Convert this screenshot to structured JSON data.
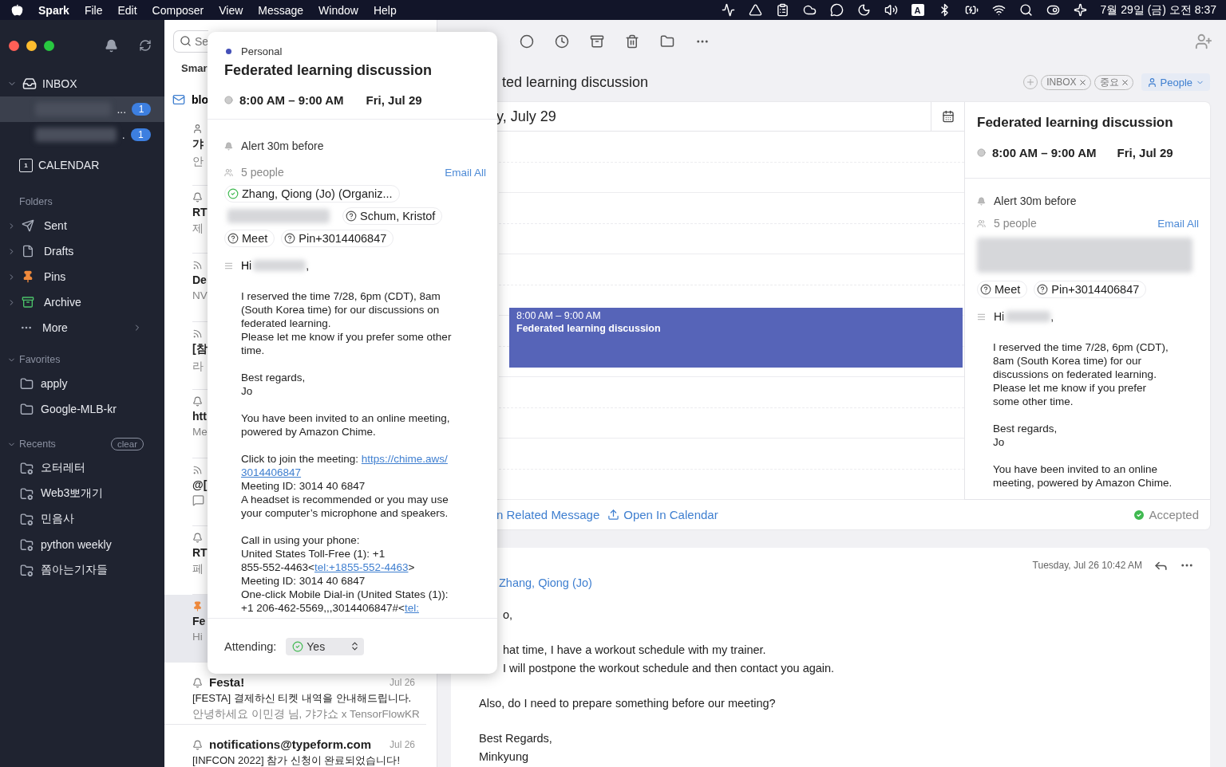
{
  "menu_bar": {
    "app": "Spark",
    "menus": [
      "File",
      "Edit",
      "Composer",
      "View",
      "Message",
      "Window",
      "Help"
    ],
    "input_source": "A",
    "clock": "7월 29일 (금) 오전 8:37"
  },
  "sidebar": {
    "inbox": {
      "label": "INBOX",
      "expanded": true,
      "accounts": [
        {
          "tail": "...",
          "count": "1",
          "selected": true
        },
        {
          "tail": ".",
          "count": "1",
          "selected": false
        }
      ]
    },
    "calendar": {
      "label": "CALENDAR",
      "day": "1"
    },
    "folders": {
      "title": "Folders",
      "items": [
        {
          "label": "Sent",
          "kind": "sent",
          "expanded": false
        },
        {
          "label": "Drafts",
          "kind": "drafts",
          "expanded": false
        },
        {
          "label": "Pins",
          "kind": "pins",
          "expanded": false
        },
        {
          "label": "Archive",
          "kind": "archive",
          "expanded": false
        },
        {
          "label": "More",
          "kind": "more"
        }
      ]
    },
    "favorites": {
      "title": "Favorites",
      "expanded": true,
      "items": [
        "apply",
        "Google-MLB-kr"
      ]
    },
    "recents": {
      "title": "Recents",
      "expanded": true,
      "clear": "clear",
      "items": [
        "오터레터",
        "Web3뽀개기",
        "민음사",
        "python weekly",
        "쫌아는기자들"
      ]
    }
  },
  "message_list": {
    "search_placeholder": "Se",
    "tab": "Smar",
    "header": "blo",
    "items": [
      {
        "kind": "person",
        "title": "갸",
        "preview": "안",
        "selected": false
      },
      {
        "kind": "bell",
        "title": "RT",
        "preview": "제",
        "selected": false
      },
      {
        "kind": "rss",
        "title": "De",
        "preview": "NV",
        "selected": false
      },
      {
        "kind": "rss",
        "title": "[참",
        "preview": "라",
        "selected": false
      },
      {
        "kind": "bell",
        "title": "htt",
        "preview": "Me",
        "selected": false
      },
      {
        "kind": "rss",
        "title": "@[",
        "chat_icon": true,
        "selected": false
      },
      {
        "kind": "bell",
        "title": "RT",
        "preview": "페",
        "selected": false
      },
      {
        "kind": "pin",
        "title": "Fe",
        "preview": "Hi",
        "selected": true
      }
    ],
    "full_items": [
      {
        "sender": "Festa!",
        "date": "Jul 26",
        "subject": "[FESTA] 결제하신 티켓 내역을 안내해드립니다.",
        "preview": "안녕하세요 이민경 님, 갸갸쇼 x TensorFlowKR",
        "selected": false
      },
      {
        "sender": "notifications@typeform.com",
        "date": "Jul 26",
        "subject": "[INFCON 2022] 참가 신청이 완료되었습니다!",
        "selected": false
      }
    ]
  },
  "thread": {
    "subject": "ted learning discussion",
    "tags": [
      "INBOX",
      "중요"
    ],
    "people": "People",
    "event_card": {
      "day": "y, July 29",
      "event": {
        "time": "8:00 AM – 9:00 AM",
        "title": "Federated learning discussion"
      },
      "details": {
        "title": "Federated learning discussion",
        "time": "8:00 AM – 9:00 AM",
        "date": "Fri, Jul 29",
        "alert": "Alert 30m before",
        "people": "5 people",
        "email_all": "Email All",
        "chips": [
          {
            "label": "Meet",
            "accepted": false
          },
          {
            "label": "Pin+3014406847",
            "accepted": false
          }
        ],
        "greeting": "Hi",
        "greeting_end": ",",
        "paragraphs": [
          [
            "I reserved the time 7/28, 6pm (CDT),",
            "8am (South Korea time) for our",
            "discussions on federated learning.",
            "Please let me know if you prefer",
            "some other time."
          ],
          [
            "Best regards,",
            "Jo"
          ],
          [
            "You have been invited to an online",
            "meeting, powered by Amazon Chime."
          ]
        ]
      },
      "footer": {
        "related": "n Related Message",
        "open": "Open In Calendar",
        "status": "Accepted"
      }
    },
    "message": {
      "date": "Tuesday, Jul 26 10:42 AM",
      "from": "Zhang, Qiong (Jo)",
      "paragraphs": [
        {
          "covered": true,
          "lines": [
            "o,"
          ]
        },
        {
          "covered": true,
          "lines": [
            "hat time, I have a workout schedule with my trainer.",
            "I will postpone the workout schedule and then contact you again."
          ]
        },
        {
          "lines": [
            "Also, do I need to prepare something before our meeting?"
          ]
        },
        {
          "lines": [
            "Best Regards,",
            "Minkyung"
          ]
        }
      ]
    }
  },
  "event_popup": {
    "calendar": "Personal",
    "title": "Federated learning discussion",
    "time": "8:00 AM – 9:00 AM",
    "date": "Fri, Jul 29",
    "alert": "Alert 30m before",
    "people": "5 people",
    "email_all": "Email All",
    "chips": [
      {
        "kind": "person",
        "label": "Zhang, Qiong (Jo) (Organiz...",
        "accepted": true
      },
      {
        "kind": "blurred"
      },
      {
        "kind": "person",
        "label": "Schum, Kristof",
        "accepted": false
      },
      {
        "kind": "person",
        "label": "Meet",
        "accepted": false
      },
      {
        "kind": "person",
        "label": "Pin+3014406847",
        "accepted": false
      }
    ],
    "greeting": "Hi",
    "greeting_end": ",",
    "paragraphs": [
      [
        "I reserved the time 7/28, 6pm (CDT), 8am",
        "(South Korea time) for our discussions on",
        "federated learning.",
        "Please let me know if you prefer some other",
        "time."
      ],
      [
        "Best regards,",
        "Jo"
      ],
      [
        "You have been invited to an online meeting,",
        "powered by Amazon Chime."
      ],
      [
        [
          {
            "text": "Click to join the meeting: "
          },
          {
            "link": "https://chime.aws/"
          }
        ],
        [
          {
            "link": "3014406847"
          }
        ],
        "Meeting ID: 3014 40 6847",
        "A headset is recommended or you may use",
        "your computer’s microphone and speakers."
      ],
      [
        "Call in using your phone:",
        "United States Toll-Free (1): +1",
        [
          {
            "text": "855-552-4463<"
          },
          {
            "link": "tel:+1855-552-4463"
          },
          {
            "text": ">"
          }
        ],
        "Meeting ID: 3014 40 6847",
        "One-click Mobile Dial-in (United States (1)):",
        [
          {
            "text": "+1 206-462-5569,,,3014406847#<"
          },
          {
            "link": "tel:"
          }
        ]
      ]
    ],
    "attending": {
      "label": "Attending:",
      "value": "Yes"
    }
  }
}
